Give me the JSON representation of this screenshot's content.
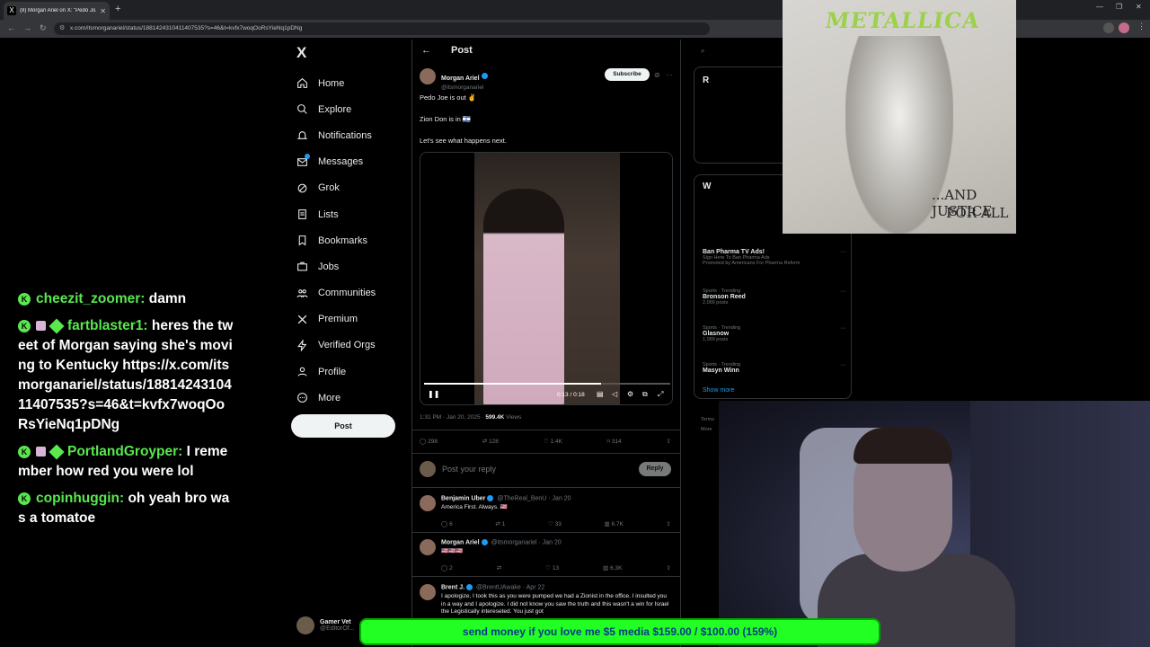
{
  "browser": {
    "tab_title": "(8) Morgan Ariel on X: \"Pedo Jo...",
    "url": "x.com/itsmorganariel/status/1881424310411407535?s=46&t=kvfx7woqOoRsYieNq1pDNg"
  },
  "x": {
    "logo": "X",
    "nav": [
      {
        "label": "Home",
        "icon": "home-icon"
      },
      {
        "label": "Explore",
        "icon": "search-icon"
      },
      {
        "label": "Notifications",
        "icon": "bell-icon"
      },
      {
        "label": "Messages",
        "icon": "mail-icon"
      },
      {
        "label": "Grok",
        "icon": "grok-icon"
      },
      {
        "label": "Lists",
        "icon": "list-icon"
      },
      {
        "label": "Bookmarks",
        "icon": "bookmark-icon"
      },
      {
        "label": "Jobs",
        "icon": "briefcase-icon"
      },
      {
        "label": "Communities",
        "icon": "people-icon"
      },
      {
        "label": "Premium",
        "icon": "x-icon"
      },
      {
        "label": "Verified Orgs",
        "icon": "lightning-icon"
      },
      {
        "label": "Profile",
        "icon": "person-icon"
      },
      {
        "label": "More",
        "icon": "more-circle-icon"
      }
    ],
    "post_button": "Post",
    "account": {
      "name": "Gamer Vet",
      "handle": "@EditorOf..."
    },
    "column": {
      "title": "Post",
      "author": {
        "name": "Morgan Ariel",
        "handle": "@itsmorganariel"
      },
      "subscribe": "Subscribe",
      "lines": [
        "Pedo Joe is out ✌️",
        "Zion Don is in 🇮🇱",
        "Let's see what happens next."
      ],
      "video": {
        "time": "0:13 / 0:18",
        "progress": 0.72
      },
      "timestamp": "1:31 PM · Jan 20, 2025 · ",
      "views": "599.4K",
      "views_label": " Views",
      "stats": {
        "replies": "298",
        "reposts": "128",
        "likes": "1.4K",
        "bookmarks": "314"
      },
      "reply_placeholder": "Post your reply",
      "reply_button": "Reply",
      "replies": [
        {
          "name": "Benjamin Uber",
          "meta": "@TheReal_BenU · Jan 20",
          "text": "America First. Always. 🇺🇸",
          "r": "6",
          "rt": "1",
          "l": "33",
          "v": "6.7K"
        },
        {
          "name": "Morgan Ariel",
          "meta": "@itsmorganariel · Jan 20",
          "text": "🇺🇸🇺🇸🇺🇸",
          "r": "2",
          "rt": "",
          "l": "13",
          "v": "6.3K"
        },
        {
          "name": "Brent J.",
          "meta": "@BrentUAwake · Apr 22",
          "text": "I apologize, I took this as you were pumped we had a Zionist in the office. I insulted you in a way and I apologize. I did not know you saw the truth and this wasn't a win for Israel the Legistically intereseted. You just got"
        }
      ]
    },
    "sidebar": {
      "r_label": "R",
      "w_label": "W",
      "ad": {
        "name": "Ban Pharma TV Ads!",
        "sub": "Sign Here To Ban Pharma Ads",
        "promo": "Promoted by Americans For Pharma Reform"
      },
      "trends": [
        {
          "cat": "Sports · Trending",
          "name": "Bronson Reed",
          "count": "2,066 posts"
        },
        {
          "cat": "Sports · Trending",
          "name": "Glasnow",
          "count": "1,099 posts"
        },
        {
          "cat": "Sports · Trending",
          "name": "Masyn Winn",
          "count": ""
        }
      ],
      "show_more": "Show more",
      "footer1": "Terms",
      "footer2": "More"
    }
  },
  "album": {
    "logo": "METALLICA",
    "line1": "...AND JUSTICE",
    "line2": "FOR ALL"
  },
  "chat": [
    {
      "user": "cheezit_zoomer:",
      "text": " damn",
      "badges": 1
    },
    {
      "user": "fartblaster1:",
      "text": " heres the tweet of Morgan saying she's moving to Kentucky https://x.com/itsmorganariel/status/1881424310411407535?s=46&t=kvfx7woqOoRsYieNq1pDNg",
      "badges": 3
    },
    {
      "user": "PortlandGroyper:",
      "text": " I remember how red you were lol",
      "badges": 3
    },
    {
      "user": "copinhuggin:",
      "text": " oh yeah bro was a tomatoe",
      "badges": 1
    }
  ],
  "donation": "send money if you love me $5 media $159.00 / $100.00 (159%)",
  "colors": {
    "accent": "#1d9bf0",
    "chat_user": "#59e84e",
    "donation_bg": "#22ff22"
  }
}
